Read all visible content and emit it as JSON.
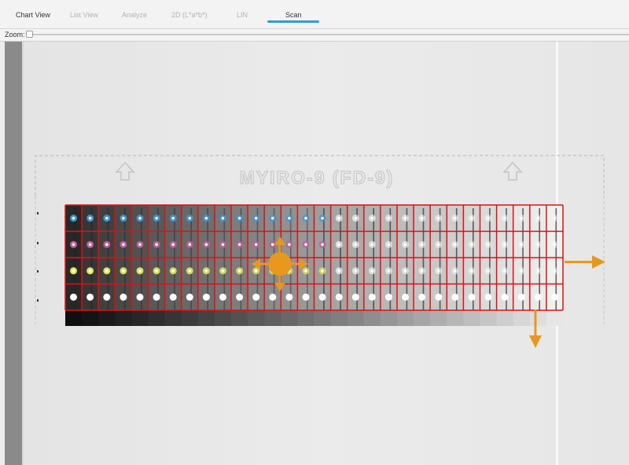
{
  "tabs": [
    {
      "label": "Chart View",
      "active": false
    },
    {
      "label": "List View",
      "active": false
    },
    {
      "label": "Analyze",
      "active": false
    },
    {
      "label": "2D (L*a*b*)",
      "active": false
    },
    {
      "label": "LIN",
      "active": false
    },
    {
      "label": "Scan",
      "active": true
    }
  ],
  "zoom": {
    "label": "Zoom:",
    "level": 0
  },
  "scan": {
    "chart_title": "MYIRO-9 (FD-9)",
    "grid": {
      "rows": 4,
      "columns": 30
    },
    "row_dot_colors": [
      "#3d96d6",
      "#c85a9a",
      "#e6e65a",
      "#ffffff"
    ],
    "grid_color": "#e01010",
    "handle_color": "#e8981e"
  },
  "colors": {
    "accent": "#2d9cdb",
    "scan_background": "#e8e8e8",
    "side_panel": "#8a8a8a"
  },
  "icons": [
    "move-handle-icon",
    "resize-right-icon",
    "resize-down-icon",
    "up-arrow-icon"
  ]
}
